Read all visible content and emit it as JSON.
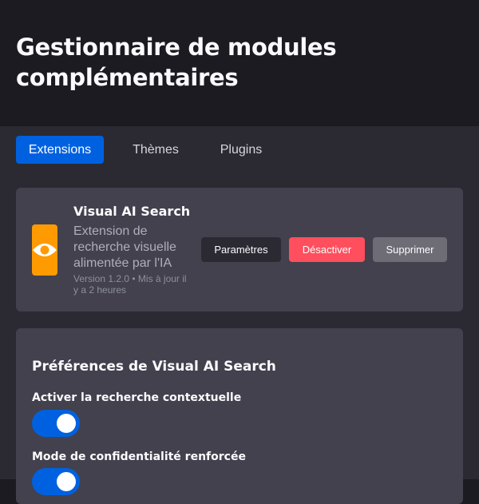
{
  "header": {
    "title": "Gestionnaire de modules complémentaires"
  },
  "tabs": [
    {
      "label": "Extensions",
      "active": true
    },
    {
      "label": "Thèmes",
      "active": false
    },
    {
      "label": "Plugins",
      "active": false
    }
  ],
  "addon": {
    "name": "Visual AI Search",
    "description": "Extension de recherche visuelle alimentée par l'IA",
    "meta": "Version 1.2.0 • Mis à jour il y a 2 heures",
    "icon": "eye-icon",
    "icon_color": "#ff9a00",
    "buttons": {
      "settings": "Paramètres",
      "disable": "Désactiver",
      "remove": "Supprimer"
    }
  },
  "preferences": {
    "title": "Préférences de Visual AI Search",
    "items": [
      {
        "label": "Activer la recherche contextuelle",
        "enabled": true
      },
      {
        "label": "Mode de confidentialité renforcée",
        "enabled": true
      }
    ]
  },
  "colors": {
    "accent": "#0061e0",
    "danger": "#ff4f5e",
    "card": "#42414d",
    "background": "#2b2a33"
  }
}
